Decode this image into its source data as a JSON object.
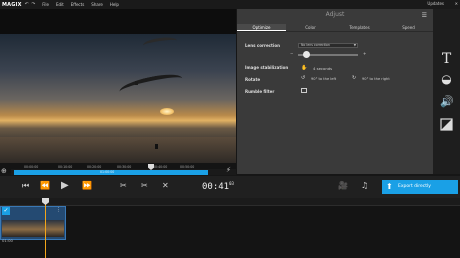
{
  "menubar": {
    "brand": "MAGIX",
    "items": [
      "File",
      "Edit",
      "Effects",
      "Share",
      "Help"
    ],
    "updates": "Updates"
  },
  "panel": {
    "title": "Adjust",
    "tabs": [
      "Optimize",
      "Color",
      "Templates",
      "Speed"
    ],
    "active_tab": "Optimize",
    "lens_label": "Lens correction",
    "lens_value": "No lens correction",
    "stab_label": "Image stabilization",
    "stab_value": "4 seconds",
    "rotate_label": "Rotate",
    "rotate_left": "90° to the left",
    "rotate_right": "90° to the right",
    "rumble_label": "Rumble filter"
  },
  "ruler": {
    "ticks": [
      "00:00:00",
      "00:10:00",
      "00:20:00",
      "00:30:00",
      "00:40:00",
      "00:50:00"
    ],
    "position": "01:00:00"
  },
  "transport": {
    "timecode": "00:41",
    "timecode_frames": "03",
    "export_label": "Export directly"
  },
  "timeline": {
    "clip_time": "01:00"
  },
  "colors": {
    "accent": "#1aa0e6",
    "playhead": "#f2a51a"
  },
  "icons": [
    "undo-icon",
    "redo-icon",
    "text-icon",
    "color-icon",
    "audio-icon",
    "adjust-icon",
    "zoom-icon",
    "snap-icon",
    "skip-start-icon",
    "rewind-icon",
    "play-icon",
    "forward-icon",
    "cut-icon",
    "split-icon",
    "delete-icon",
    "camera-icon",
    "music-icon",
    "export-icon"
  ]
}
